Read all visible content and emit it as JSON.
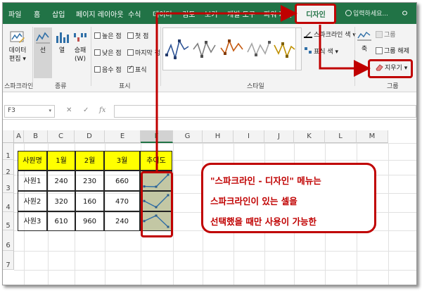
{
  "tabs": [
    {
      "id": "file",
      "label": "파일"
    },
    {
      "id": "home",
      "label": "홈"
    },
    {
      "id": "insert",
      "label": "삽입"
    },
    {
      "id": "pagelayout",
      "label": "페이지 레이아웃"
    },
    {
      "id": "formulas",
      "label": "수식"
    },
    {
      "id": "data",
      "label": "데이터"
    },
    {
      "id": "review",
      "label": "검토"
    },
    {
      "id": "view",
      "label": "보기"
    },
    {
      "id": "developer",
      "label": "개발 도구"
    },
    {
      "id": "powerpivot",
      "label": "파워 피벗"
    },
    {
      "id": "design",
      "label": "디자인"
    }
  ],
  "tell_me": "입력하세요...",
  "user_icon": "ㅇ",
  "ribbon": {
    "edit_data": {
      "line1": "데이터",
      "line2": "편집 ▾"
    },
    "sparkline_group": "스파크라인",
    "type_group": "종류",
    "type_line": "선",
    "type_column": "열",
    "type_winloss_1": "승패",
    "type_winloss_2": "(W)",
    "show_group": "표시",
    "checks": {
      "high": "높은 점",
      "first": "첫 점",
      "low": "낮은 점",
      "last": "마지막 점",
      "negative": "음수 점",
      "markers": "표식"
    },
    "style_group": "스타일",
    "sparkline_color": "스파크라인 색 ▾",
    "marker_color": "표식 색 ▾",
    "axis": "축",
    "group_group": "그룹",
    "group_btn": "그룹",
    "ungroup_btn": "그룹 해제",
    "clear_btn": "지우기",
    "clear_dd": "▾"
  },
  "formula_bar": {
    "name_box": "F3",
    "name_dd": "▾",
    "cancel": "✕",
    "enter": "✓",
    "fx": "fx"
  },
  "columns": [
    "A",
    "B",
    "C",
    "D",
    "E",
    "F",
    "G",
    "H",
    "I",
    "J",
    "K",
    "L",
    "M"
  ],
  "rows": [
    "1",
    "2",
    "3",
    "4",
    "5",
    "6",
    "7"
  ],
  "table": {
    "header": [
      "사원명",
      "1월",
      "2월",
      "3월",
      "추이도"
    ],
    "rows": [
      [
        "사원1",
        "240",
        "230",
        "660"
      ],
      [
        "사원2",
        "320",
        "160",
        "470"
      ],
      [
        "사원3",
        "610",
        "960",
        "240"
      ]
    ]
  },
  "sparklines": [
    [
      240,
      230,
      660
    ],
    [
      320,
      160,
      470
    ],
    [
      610,
      960,
      240
    ]
  ],
  "callout": {
    "line1": "\"스파크라인 - 디자인\" 메뉴는",
    "line2": "스파크라인이 있는 셀을",
    "line3": "선택했을 때만 사용이 가능한"
  },
  "colors": {
    "excel_green": "#217346",
    "highlight_red": "#c00000",
    "header_yellow": "#ffff00",
    "sparkline_cell": "#c3c7a4",
    "sparkline_line": "#2f6fa7"
  }
}
